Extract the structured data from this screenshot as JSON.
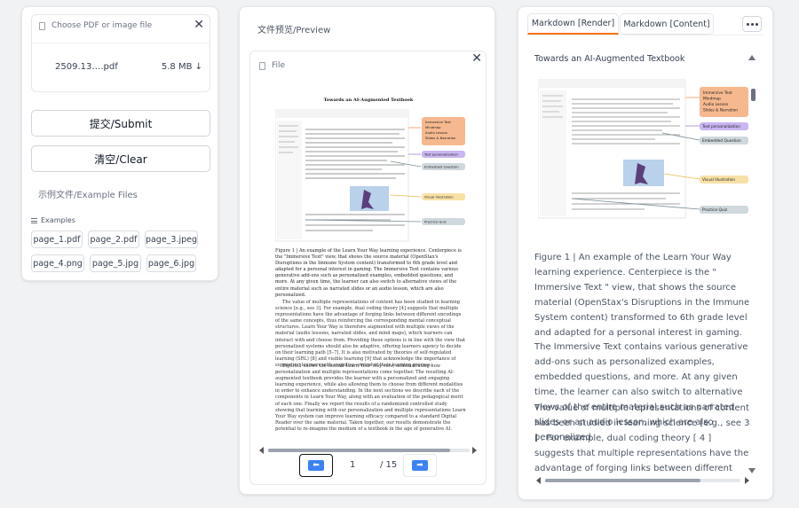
{
  "upload": {
    "placeholder": "Choose PDF or image file",
    "file_name": "2509.13….pdf",
    "file_size": "5.8 MB ↓"
  },
  "buttons": {
    "submit": "提交/Submit",
    "clear": "清空/Clear"
  },
  "examples": {
    "section_label": "示例文件/Example Files",
    "header": "Examples",
    "files": [
      "page_1.pdf",
      "page_2.pdf",
      "page_3.jpeg",
      "page_4.png",
      "page_5.jpg",
      "page_6.jpg"
    ]
  },
  "preview": {
    "title": "文件预览/Preview",
    "file_label": "File",
    "page_current": "1",
    "page_total": "/ 15",
    "pdf": {
      "title": "Towards an AI-Augmented Textbook",
      "callouts": [
        "Immersive Text",
        "Mindmap",
        "Audio Lesson",
        "Slides & Narration",
        "Text personalization",
        "Embedded Question",
        "Visual Illustration",
        "Practice Quiz"
      ],
      "caption": "Figure 1 | An example of the Learn Your Way learning experience. Centerpiece is the \"Immersive Text\" view, that shows the source material (OpenStax's Disruptions in the Immune System content) transformed to 6th grade level and adapted for a personal interest in gaming. The Immersive Text contains various generative add-ons such as personalized examples, embedded questions, and more. At any given time, the learner can also switch to alternative views of the entire material such as narrated slides or an audio lesson, which are also personalized.",
      "para1": "The value of multiple representations of content has been studied in learning science [e.g., see 3]. For example, dual coding theory [4] suggests that multiple representations have the advantage of forging links between different encodings of the same concepts, thus reinforcing the corresponding mental conceptual structures. Learn Your Way is therefore augmented with multiple views of the material (audio lessons, narrated slides, and mind maps), which learners can interact with and choose from. Providing these options is in line with the view that personalized systems should also be adaptive, offering learners agency to decide on their learning path [5–7]. It is also motivated by theories of self-regulated learning (SRL) [8] and visible learning [9] that acknowledge the importance of supporting learners with cognitive control of their learning process.",
      "para2": "Figure 1 shows the central Learn Your Way view, demonstrating how personalization and multiple representations come together. The resulting AI-augmented textbook provides the learner with a personalized and engaging learning experience, while also allowing them to choose from different modalities in order to enhance understanding. In the next sections we describe each of the components in Learn Your Way, along with an evaluation of the pedagogical merit of each one. Finally we report the results of a randomized controlled study showing that learning with our personalization and multiple representations Learn Your Way system can improve learning efficacy compared to a standard Digital Reader over the same material. Taken together, our results demonstrate the potential to re-imagine the medium of a textbook in the age of generative AI."
    }
  },
  "markdown": {
    "tab_render": "Markdown [Render]",
    "tab_content": "Markdown [Content]",
    "heading": "Towards an AI-Augmented Textbook",
    "callouts": [
      "Immersive Text",
      "Mindmap",
      "Audio Lesson",
      "Slides & Narration",
      "Text personalization",
      "Embedded Question",
      "Visual Illustration",
      "Practice Quiz"
    ],
    "caption": "Figure 1 | An example of the Learn Your Way learning experience. Centerpiece is the \" Immersive Text \" view, that shows the source material (OpenStax's Disruptions in the Immune System content) transformed to 6th grade level and adapted for a personal interest in gaming. The Immersive Text contains various generative add-ons such as personalized examples, embedded questions, and more. At any given time, the learner can also switch to alternative views of the entire material such as narrated slides or an audio lesson, which are also personalized.",
    "para1": "The value of multiple representations of content has been studied in learning science [e.g., see 3 ] . For example, dual coding theory [ 4 ] suggests that multiple representations have the advantage of forging links between different encodings of the same concepts, thus reinforcing the"
  },
  "colors": {
    "accent": "#f97316",
    "link_blue": "#3b82f6",
    "callout_orange": "#f6b98f",
    "callout_purple": "#c9b6f2",
    "callout_gray": "#cfd8dc",
    "callout_yellow": "#f8e1a6"
  }
}
